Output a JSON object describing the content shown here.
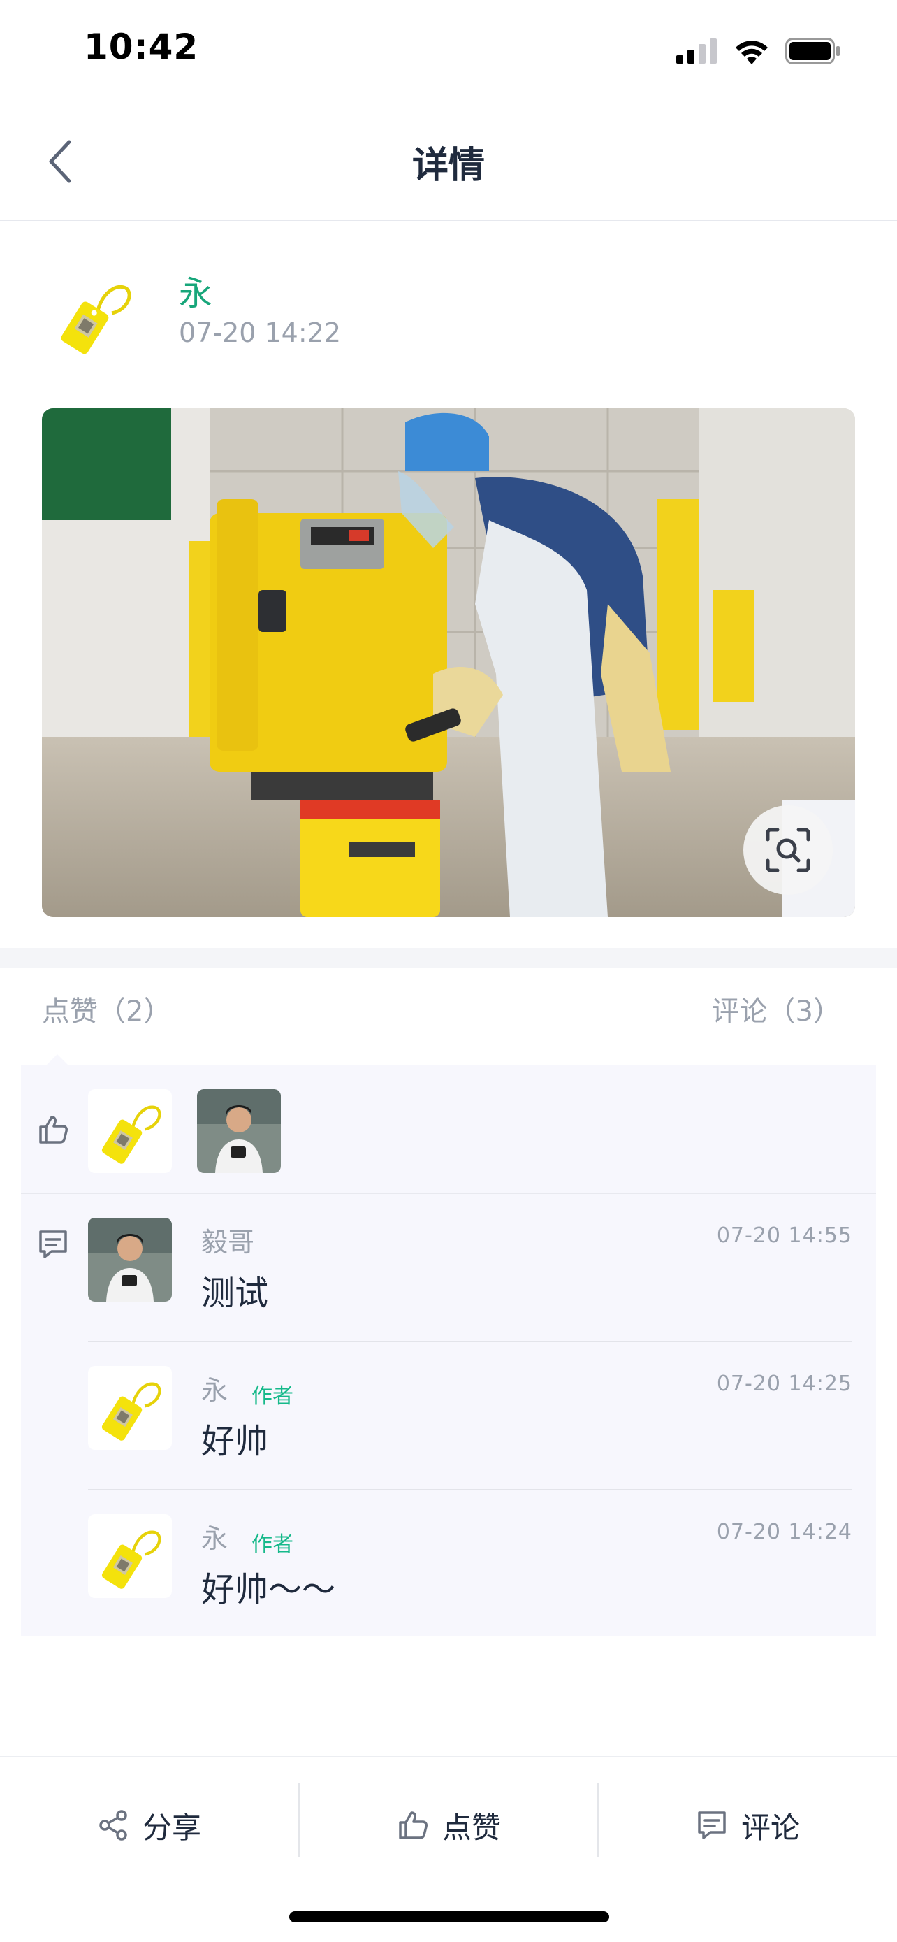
{
  "status_bar": {
    "time": "10:42"
  },
  "nav": {
    "title": "详情"
  },
  "post": {
    "author": "永",
    "time": "07-20 14:22",
    "photo_icon": "scan-search-icon"
  },
  "tabs": {
    "likes": "点赞（2）",
    "comments": "评论（3）"
  },
  "likes": [
    {
      "avatar": "tag-avatar"
    },
    {
      "avatar": "person-avatar"
    }
  ],
  "comments": [
    {
      "name": "毅哥",
      "badge": "",
      "time": "07-20 14:55",
      "text": "测试",
      "avatar": "person-avatar"
    },
    {
      "name": "永",
      "badge": "作者",
      "time": "07-20 14:25",
      "text": "好帅",
      "avatar": "tag-avatar"
    },
    {
      "name": "永",
      "badge": "作者",
      "time": "07-20 14:24",
      "text": "好帅～～",
      "avatar": "tag-avatar"
    }
  ],
  "bottom_bar": {
    "share": "分享",
    "like": "点赞",
    "comment": "评论"
  },
  "colors": {
    "accent_green": "#17a67a",
    "badge_green": "#16b98a",
    "panel_bg": "#f7f7fd",
    "muted": "#9aa1ad"
  }
}
